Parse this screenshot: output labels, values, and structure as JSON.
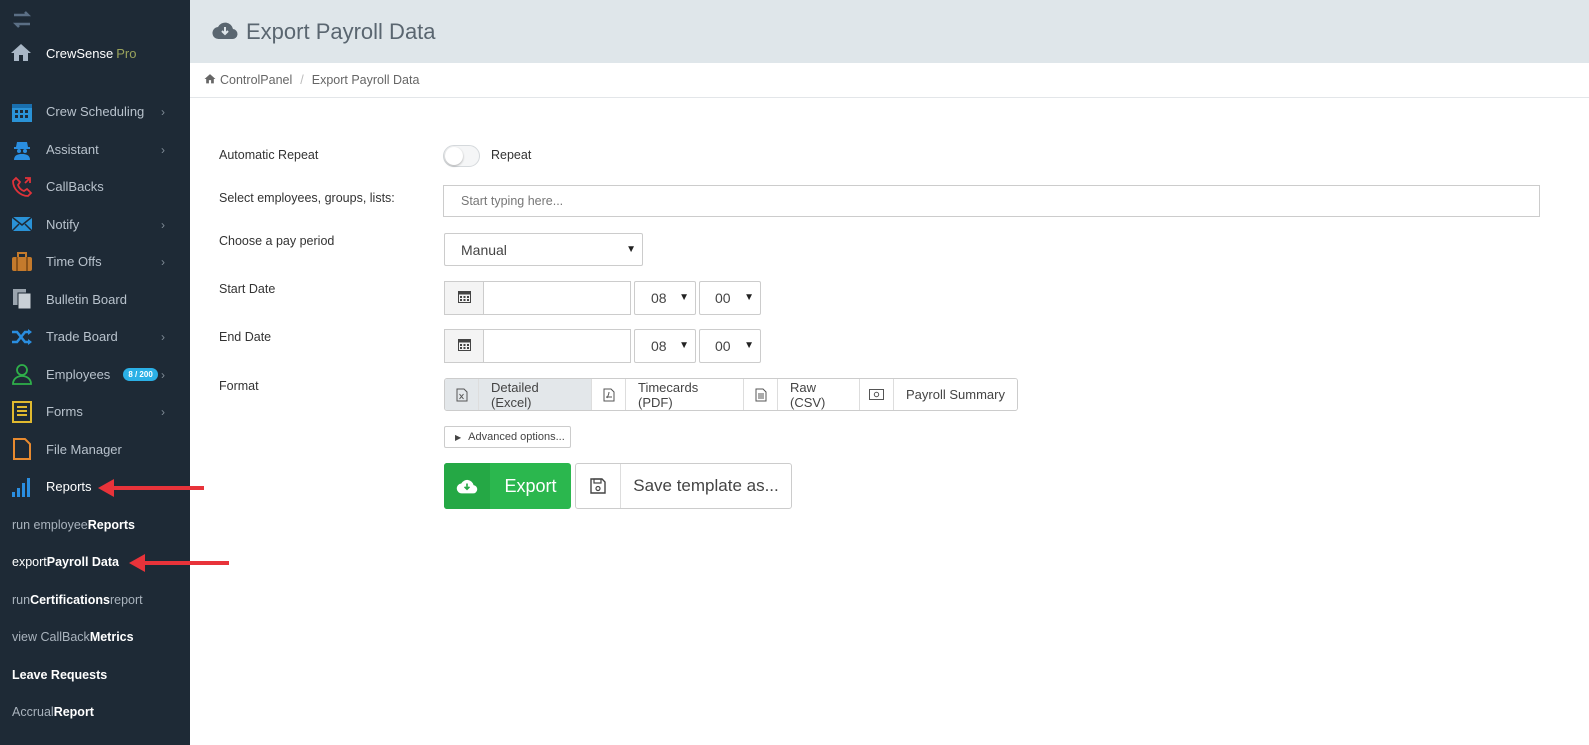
{
  "brand": {
    "name": "CrewSense",
    "tier": "Pro"
  },
  "sidebar": {
    "items": [
      {
        "label": "Crew Scheduling",
        "icon": "calendar-icon",
        "has_chevron": true
      },
      {
        "label": "Assistant",
        "icon": "assistant-icon",
        "has_chevron": true
      },
      {
        "label": "CallBacks",
        "icon": "phone-icon",
        "has_chevron": false
      },
      {
        "label": "Notify",
        "icon": "envelope-icon",
        "has_chevron": true
      },
      {
        "label": "Time Offs",
        "icon": "briefcase-icon",
        "has_chevron": true
      },
      {
        "label": "Bulletin Board",
        "icon": "documents-icon",
        "has_chevron": false
      },
      {
        "label": "Trade Board",
        "icon": "shuffle-icon",
        "has_chevron": true
      },
      {
        "label": "Employees",
        "icon": "user-icon",
        "has_chevron": true,
        "badge": "8 / 200"
      },
      {
        "label": "Forms",
        "icon": "form-icon",
        "has_chevron": true
      },
      {
        "label": "File Manager",
        "icon": "file-icon",
        "has_chevron": false
      },
      {
        "label": "Reports",
        "icon": "bar-chart-icon",
        "has_chevron": false
      }
    ],
    "subitems": [
      {
        "pre": "run employee ",
        "bold": "Reports",
        "post": ""
      },
      {
        "pre": "export ",
        "bold": "Payroll Data",
        "post": ""
      },
      {
        "pre": "run ",
        "bold": "Certifications",
        "post": " report"
      },
      {
        "pre": "view CallBack ",
        "bold": "Metrics",
        "post": ""
      },
      {
        "pre": "",
        "bold": "Leave Requests",
        "post": ""
      },
      {
        "pre": "Accrual ",
        "bold": "Report",
        "post": ""
      }
    ]
  },
  "header": {
    "title": "Export Payroll Data"
  },
  "breadcrumb": {
    "home": "ControlPanel",
    "current": "Export Payroll Data"
  },
  "form": {
    "automatic_repeat_label": "Automatic Repeat",
    "repeat_toggle_label": "Repeat",
    "select_label": "Select employees, groups, lists:",
    "select_placeholder": "Start typing here...",
    "pay_period_label": "Choose a pay period",
    "pay_period_value": "Manual",
    "start_date_label": "Start Date",
    "start_hour": "08",
    "start_minute": "00",
    "end_date_label": "End Date",
    "end_hour": "08",
    "end_minute": "00",
    "format_label": "Format",
    "formats": [
      "Detailed (Excel)",
      "Timecards (PDF)",
      "Raw (CSV)",
      "Payroll Summary"
    ],
    "advanced_label": "Advanced options...",
    "export_label": "Export",
    "save_template_label": "Save template as..."
  },
  "colors": {
    "sidebar_bg": "#1e2a36",
    "accent_green": "#2bb74e",
    "annotation_arrow": "#e8333a"
  }
}
